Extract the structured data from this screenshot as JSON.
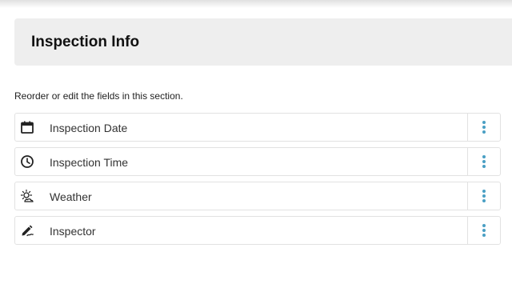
{
  "section": {
    "title": "Inspection Info",
    "helper_text": "Reorder or edit the fields in this section."
  },
  "fields": [
    {
      "label": "Inspection Date",
      "icon": "calendar-icon"
    },
    {
      "label": "Inspection Time",
      "icon": "clock-icon"
    },
    {
      "label": "Weather",
      "icon": "weather-icon"
    },
    {
      "label": "Inspector",
      "icon": "pencil-signature-icon"
    }
  ],
  "colors": {
    "menu_dots": "#4a9fc4",
    "header_bg": "#eeeeee"
  }
}
